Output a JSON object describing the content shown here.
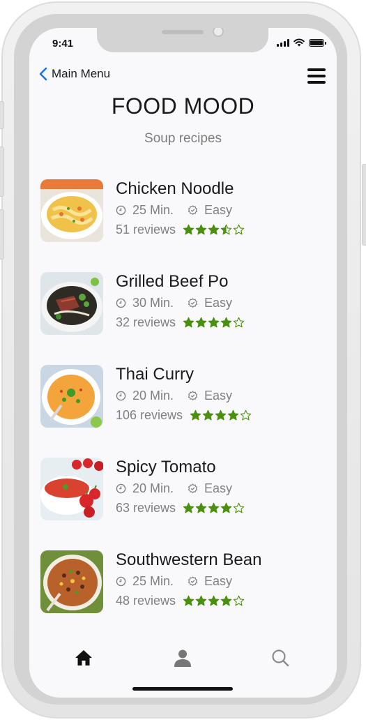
{
  "status_bar": {
    "time": "9:41"
  },
  "nav": {
    "back_label": "Main Menu"
  },
  "header": {
    "title": "FOOD MOOD",
    "subtitle": "Soup recipes"
  },
  "colors": {
    "star": "#4a8f0f",
    "text": "#1a1a1a",
    "muted": "#808080"
  },
  "recipes": [
    {
      "name": "Chicken Noodle",
      "time": "25 Min.",
      "difficulty": "Easy",
      "reviews": "51 reviews",
      "rating": 3.5
    },
    {
      "name": "Grilled Beef Po",
      "time": "30 Min.",
      "difficulty": "Easy",
      "reviews": "32 reviews",
      "rating": 4
    },
    {
      "name": "Thai Curry",
      "time": "20 Min.",
      "difficulty": "Easy",
      "reviews": "106 reviews",
      "rating": 4
    },
    {
      "name": "Spicy Tomato",
      "time": "20 Min.",
      "difficulty": "Easy",
      "reviews": "63 reviews",
      "rating": 4
    },
    {
      "name": "Southwestern Bean",
      "time": "25 Min.",
      "difficulty": "Easy",
      "reviews": "48 reviews",
      "rating": 4
    }
  ],
  "tab_bar": {
    "icons": [
      "home-icon",
      "profile-icon",
      "search-icon"
    ],
    "active": "home-icon"
  }
}
